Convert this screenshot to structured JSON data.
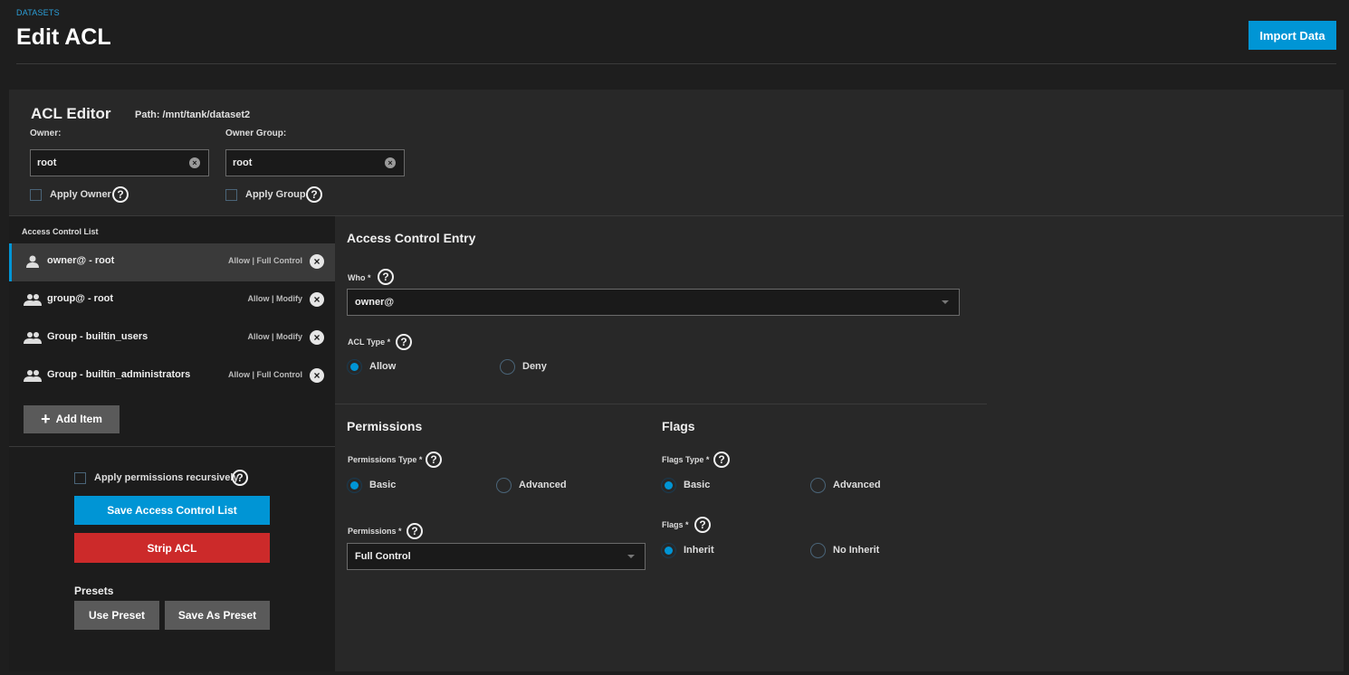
{
  "header": {
    "breadcrumb": "DATASETS",
    "title": "Edit ACL",
    "import_label": "Import Data"
  },
  "editor": {
    "title": "ACL Editor",
    "path": "Path:  /mnt/tank/dataset2",
    "owner_label": "Owner:",
    "owner_value": "root",
    "group_label": "Owner Group:",
    "group_value": "root",
    "apply_owner": "Apply Owner",
    "apply_group": "Apply Group"
  },
  "acl_list": {
    "title": "Access Control List",
    "items": [
      {
        "label": "owner@ - root",
        "perm": "Allow | Full Control",
        "icon": "user-icon"
      },
      {
        "label": "group@ - root",
        "perm": "Allow | Modify",
        "icon": "group-icon"
      },
      {
        "label": "Group - builtin_users",
        "perm": "Allow | Modify",
        "icon": "group-icon"
      },
      {
        "label": "Group - builtin_administrators",
        "perm": "Allow | Full Control",
        "icon": "group-icon"
      }
    ],
    "add_item": "Add Item",
    "apply_recursive": "Apply permissions recursively",
    "save_label": "Save Access Control List",
    "strip_label": "Strip ACL",
    "presets_title": "Presets",
    "use_preset": "Use Preset",
    "save_preset": "Save As Preset"
  },
  "entry": {
    "title": "Access Control Entry",
    "who_label": "Who *",
    "who_value": "owner@",
    "acl_type_label": "ACL Type *",
    "acl_type_options": [
      "Allow",
      "Deny"
    ],
    "permissions_title": "Permissions",
    "perm_type_label": "Permissions Type *",
    "perm_type_options": [
      "Basic",
      "Advanced"
    ],
    "permissions_label": "Permissions *",
    "permissions_value": "Full Control",
    "flags_title": "Flags",
    "flags_type_label": "Flags Type *",
    "flags_type_options": [
      "Basic",
      "Advanced"
    ],
    "flags_label": "Flags *",
    "flags_options": [
      "Inherit",
      "No Inherit"
    ]
  },
  "colors": {
    "accent": "#0095d5",
    "danger": "#cc2a2a",
    "background": "#1e1e1e",
    "card": "#282828"
  }
}
